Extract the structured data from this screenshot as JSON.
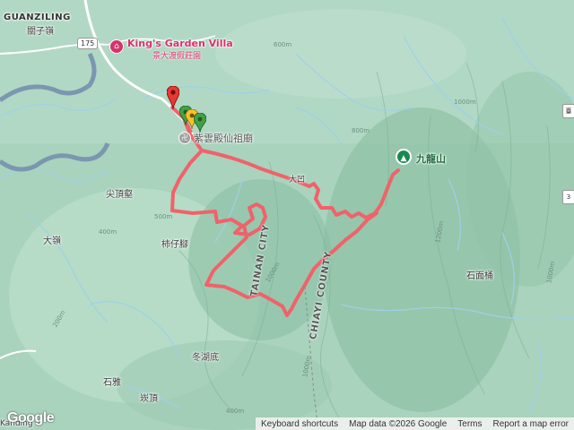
{
  "places": {
    "guanziling_en": "GUANZILING",
    "guanziling_zh": "關子嶺",
    "road_175": "175",
    "hotel_name": "King's Garden Villa",
    "hotel_sub": "景大渡假莊園",
    "temple": "紫雲殿仙祖廟",
    "peak": "九龍山",
    "jiantouxian": "尖頂壑",
    "dayu": "大嶺",
    "shizijiao": "柿仔腳",
    "shimiantong": "石面桶",
    "donghudi": "冬湖底",
    "shiya": "石雅",
    "kanding": "崁頂",
    "daao": "大凹",
    "tainan_city": "TAINAN CITY",
    "chiayi_county": "CHIAYI COUNTY",
    "kanding_en": "Kanding"
  },
  "contours": [
    "600m",
    "800m",
    "1000m",
    "500m",
    "1000m",
    "200m",
    "400m",
    "1200m",
    "1000m",
    "1000m",
    "400m"
  ],
  "edge_badges": [
    "臺",
    "3"
  ],
  "attribution": {
    "keyboard": "Keyboard shortcuts",
    "map_data": "Map data ©2026 Google",
    "terms": "Terms",
    "report": "Report a map error"
  },
  "google_logo": "Google",
  "colors": {
    "track": "#f0626a",
    "water": "#9fd0e8",
    "terrain": "#a9d3bd",
    "peak_marker": "#1a8a52",
    "pin_red": "#e53935",
    "pin_yellow": "#fbc02d",
    "pin_green": "#43a047",
    "hotel": "#d6336c"
  }
}
